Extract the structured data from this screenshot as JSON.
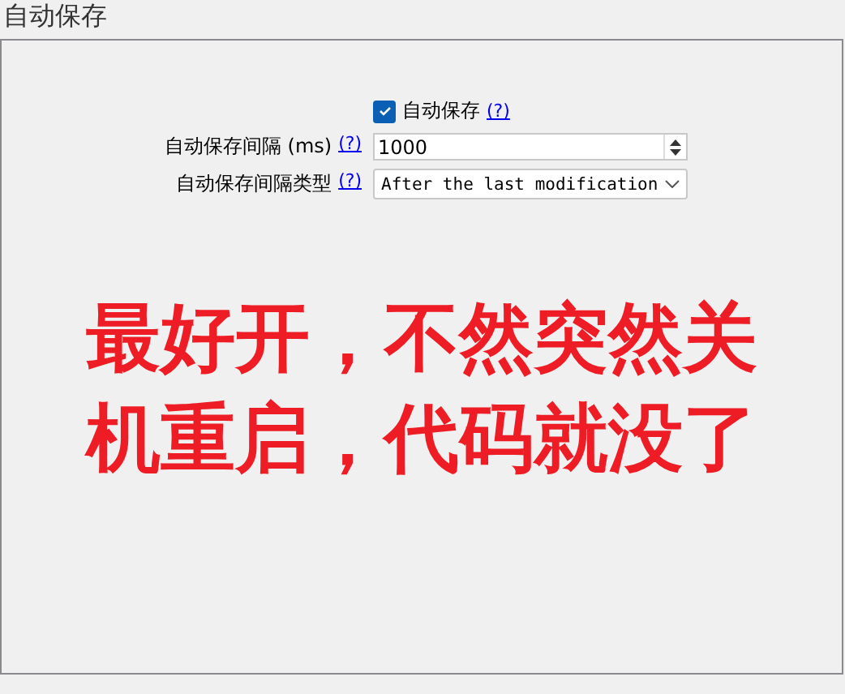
{
  "section_title": "自动保存",
  "autosave": {
    "label": "自动保存",
    "checked": true,
    "help": "(?)"
  },
  "interval": {
    "label": "自动保存间隔 (ms)",
    "help": "(?)",
    "value": "1000"
  },
  "interval_type": {
    "label": "自动保存间隔类型",
    "help": "(?)",
    "value": "After the last modification"
  },
  "annotation": [
    "最好开，不然突然关",
    "机重启，代码就没了"
  ]
}
